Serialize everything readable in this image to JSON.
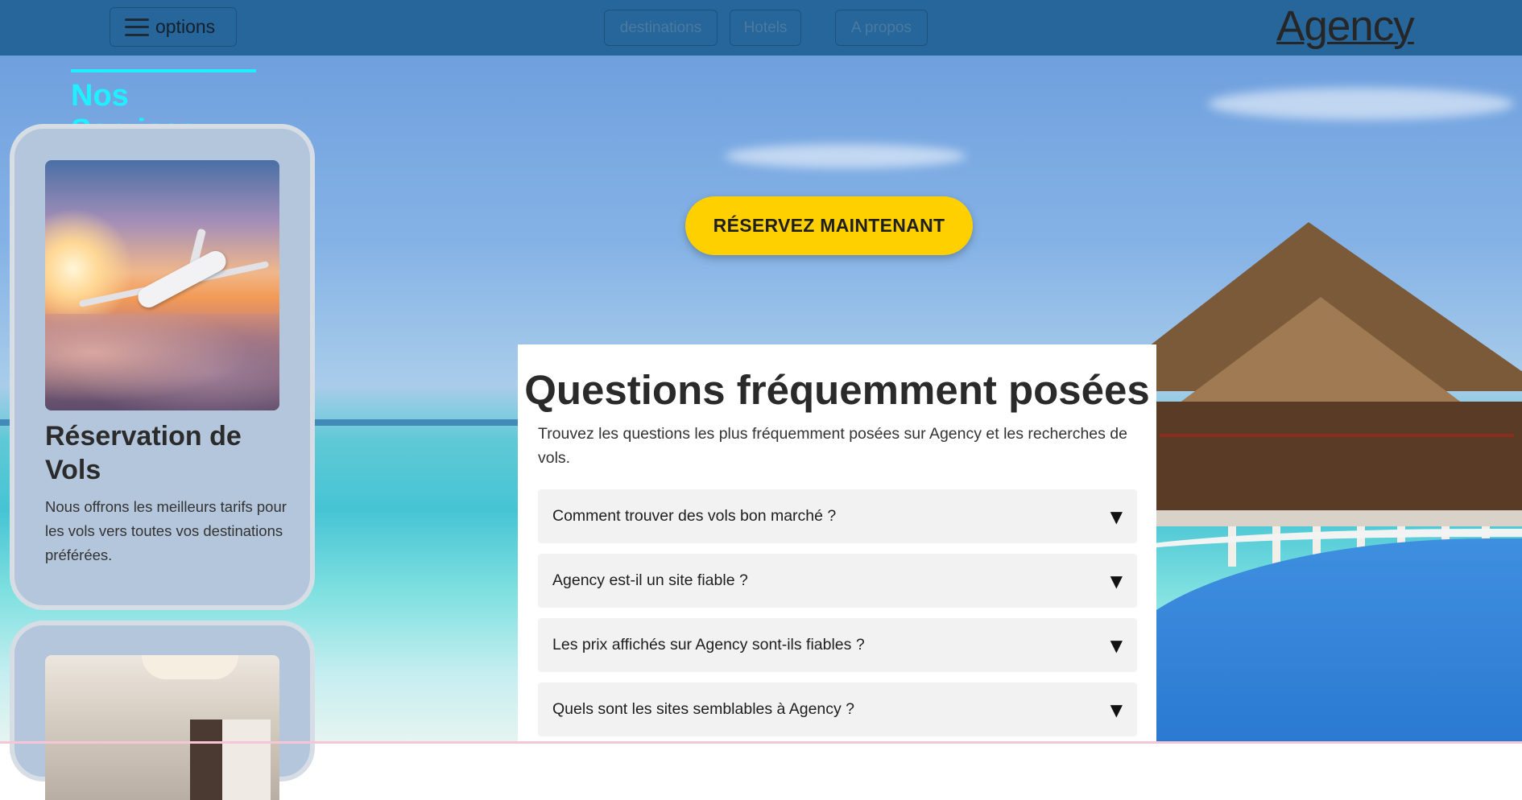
{
  "navbar": {
    "options_label": "options",
    "links": [
      "destinations",
      "Hotels",
      "A propos"
    ],
    "logo": "Agency"
  },
  "services": {
    "title": "Nos Services",
    "cards": [
      {
        "image": "airplane-sunset",
        "title": "Réservation de Vols",
        "text": "Nous offrons les meilleurs tarifs pour les vols vers toutes vos destinations préférées."
      },
      {
        "image": "hotel-room"
      }
    ]
  },
  "hero": {
    "book_button": "RÉSERVEZ MAINTENANT"
  },
  "faq": {
    "title": "Questions fréquemment posées",
    "subtitle": "Trouvez les questions les plus fréquemment posées sur Agency et les recherches de vols.",
    "items": [
      {
        "question": "Comment trouver des vols bon marché ?",
        "arrow": "▼"
      },
      {
        "question": "Agency est-il un site fiable ?",
        "arrow": "▼"
      },
      {
        "question": "Les prix affichés sur Agency sont-ils fiables ?",
        "arrow": "▼"
      },
      {
        "question": "Quels sont les sites semblables à Agency ?",
        "arrow": "▼"
      }
    ]
  },
  "colors": {
    "navbar": "#26669b",
    "accent_cyan": "#1ff0ff",
    "book_button": "#ffd000",
    "card_bg": "#b4c6dc"
  }
}
